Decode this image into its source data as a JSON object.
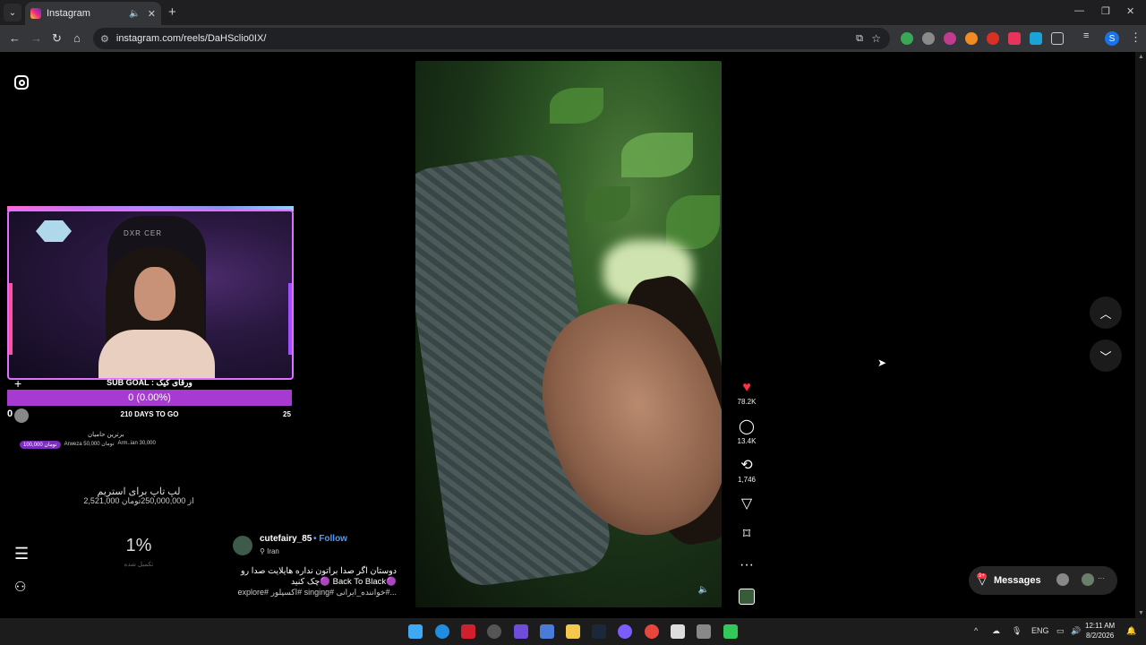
{
  "browser": {
    "tab_title": "Instagram",
    "tab_mute_icon": "speaker-icon",
    "tab_close": "✕",
    "new_tab": "+",
    "url": "instagram.com/reels/DaHSclio0IX/"
  },
  "stream_overlay": {
    "chair_text": "DXR CER",
    "goal_title": "SUB GOAL : ورقای کیک",
    "goal_progress": "0 (0.00%)",
    "goal_progress_fraction": 0.0,
    "goal_start": "0",
    "goal_days": "210 DAYS TO GO",
    "goal_end": "25",
    "donors_title": "برترین حامیان",
    "donors": [
      "100,000 تومان",
      "Arweza 50,000 تومان",
      "Arm..ian 30,000"
    ],
    "laptop_title": "لپ تاپ برای استریم",
    "laptop_amount": "2,521,000 از 250,000,000تومان",
    "percent": "1%",
    "percent_sub": "تکمیل شده"
  },
  "reel": {
    "author": "cutefairy_85",
    "follow": "Follow",
    "separator": "•",
    "location": "Iran",
    "caption_line1": "دوستان اگر صدا براتون نداره هایلایت صدا رو",
    "caption_line2": "چک کنید🟣 Back To Black🟣",
    "hashtags": "explore# اکسپلور# singing# خواننده_ایرانی#...",
    "likes": "78.2K",
    "comments": "13.4K",
    "reposts": "1,746"
  },
  "messages": {
    "label": "Messages",
    "badge": "9+"
  },
  "taskbar": {
    "lang": "ENG",
    "time": "12:11 AM",
    "date": "8/2/2026"
  }
}
